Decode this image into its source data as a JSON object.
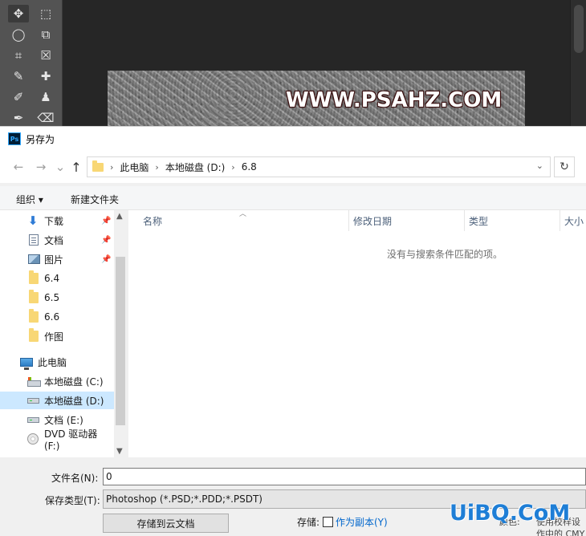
{
  "canvas": {
    "watermark_text": "WWW.PSAHZ.COM"
  },
  "dialog": {
    "title": "另存为",
    "app_icon": "Ps",
    "nav": {
      "back_icon": "arrow-left",
      "forward_icon": "arrow-right",
      "up_icon": "arrow-up",
      "breadcrumb": [
        "此电脑",
        "本地磁盘 (D:)",
        "6.8"
      ],
      "refresh_icon": "refresh"
    },
    "commands": {
      "organize": "组织 ▾",
      "new_folder": "新建文件夹"
    },
    "sidebar": {
      "items": [
        {
          "label": "下载",
          "icon": "download-icon",
          "pinned": true
        },
        {
          "label": "文档",
          "icon": "document-icon",
          "pinned": true
        },
        {
          "label": "图片",
          "icon": "picture-icon",
          "pinned": true
        },
        {
          "label": "6.4",
          "icon": "folder-icon"
        },
        {
          "label": "6.5",
          "icon": "folder-icon"
        },
        {
          "label": "6.6",
          "icon": "folder-icon"
        },
        {
          "label": "作图",
          "icon": "folder-icon"
        },
        {
          "label": "此电脑",
          "icon": "computer-icon"
        },
        {
          "label": "本地磁盘 (C:)",
          "icon": "drive-icon"
        },
        {
          "label": "本地磁盘 (D:)",
          "icon": "drive-icon",
          "selected": true
        },
        {
          "label": "文档 (E:)",
          "icon": "drive-icon"
        },
        {
          "label": "DVD 驱动器 (F:)",
          "icon": "dvd-icon"
        }
      ]
    },
    "columns": [
      "名称",
      "修改日期",
      "类型",
      "大小"
    ],
    "empty_message": "没有与搜索条件匹配的项。",
    "form": {
      "filename_label": "文件名(N):",
      "filename_value": "0",
      "filetype_label": "保存类型(T):",
      "filetype_value": "Photoshop (*.PSD;*.PDD;*.PSDT)",
      "cloud_button": "存储到云文档",
      "save_label": "存储:",
      "as_copy_label": "作为副本(Y)",
      "cut_right_1": "颜色:",
      "cut_right_2": "使用校样设",
      "cut_right_3": "作中的 CMY"
    }
  },
  "watermark": "UiBQ.CoM"
}
